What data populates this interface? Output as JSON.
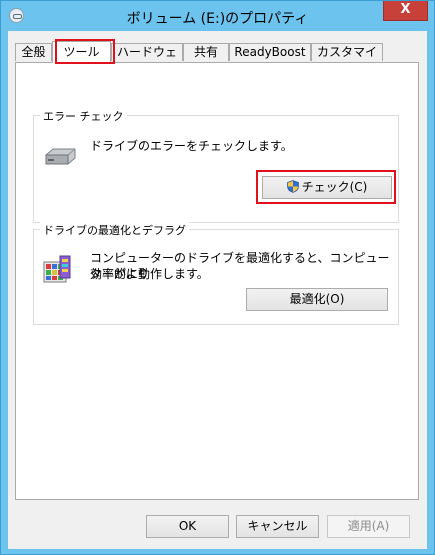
{
  "window": {
    "title": "ボリューム (E:)のプロパティ",
    "close_glyph": "X"
  },
  "tabs": [
    {
      "label": "全般",
      "active": false
    },
    {
      "label": "ツール",
      "active": true
    },
    {
      "label": "ハードウェア",
      "active": false
    },
    {
      "label": "共有",
      "active": false
    },
    {
      "label": "ReadyBoost",
      "active": false
    },
    {
      "label": "カスタマイズ",
      "active": false
    }
  ],
  "error_check": {
    "legend": "エラー チェック",
    "description": "ドライブのエラーをチェックします。",
    "button_label": "チェック(C)"
  },
  "optimize": {
    "legend": "ドライブの最適化とデフラグ",
    "description_line1": "コンピューターのドライブを最適化すると、コンピューターがより",
    "description_line2": "効率的に動作します。",
    "button_label": "最適化(O)"
  },
  "footer": {
    "ok_label": "OK",
    "cancel_label": "キャンセル",
    "apply_label": "適用(A)"
  },
  "colors": {
    "frame": "#6cc3ee",
    "close_button": "#c7413a",
    "highlight": "#e0101c"
  },
  "icons": [
    "window-system-icon",
    "drive-icon",
    "defrag-icon",
    "uac-shield-icon"
  ]
}
